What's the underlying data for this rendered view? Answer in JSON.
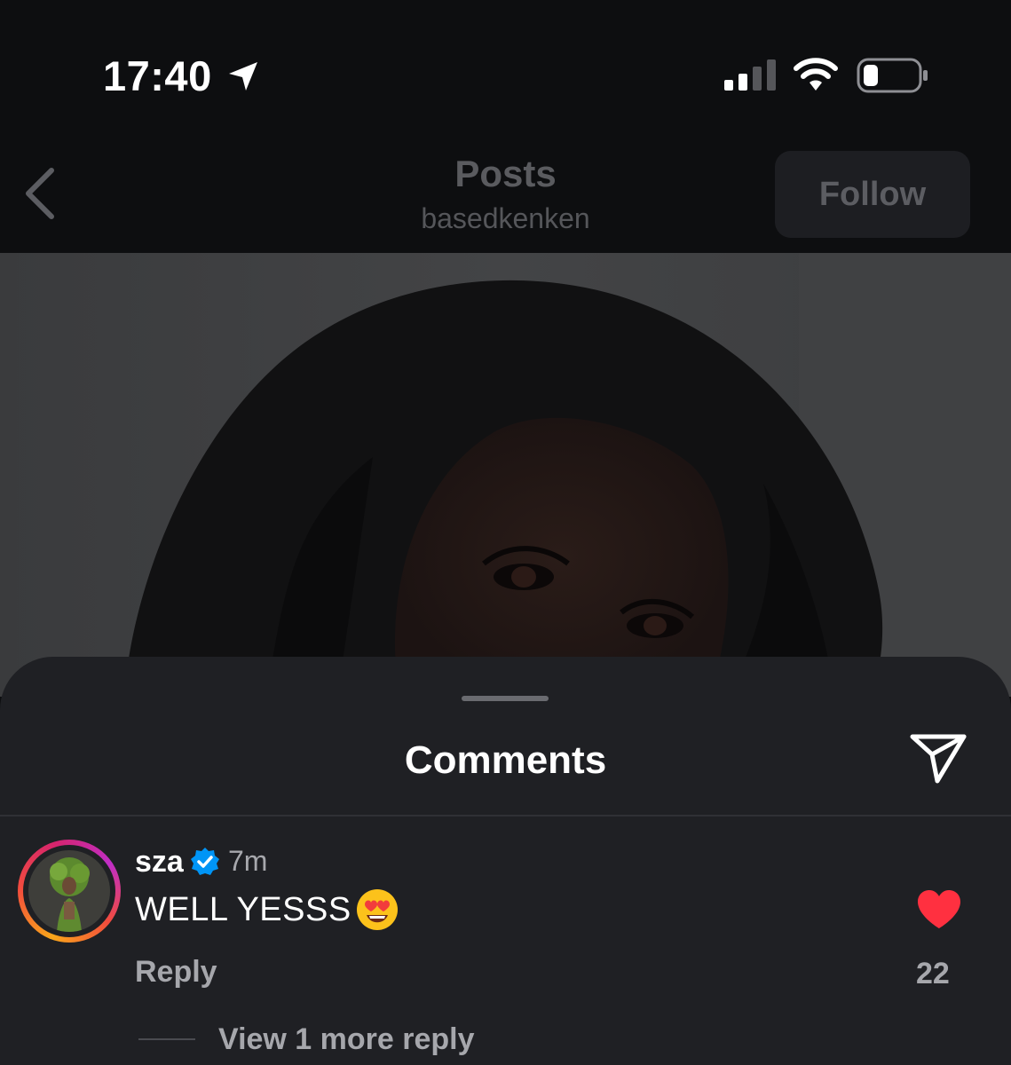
{
  "status_bar": {
    "time": "17:40",
    "icons": [
      "location-arrow-icon",
      "cellular-signal-icon",
      "wifi-icon",
      "battery-icon"
    ]
  },
  "nav": {
    "title": "Posts",
    "subtitle": "basedkenken",
    "follow_label": "Follow",
    "back_icon": "chevron-left-icon"
  },
  "comments_sheet": {
    "title": "Comments",
    "share_icon": "send-icon",
    "comments": [
      {
        "username": "sza",
        "verified": true,
        "time": "7m",
        "text": "WELL YESSS",
        "emoji": "smiling-face-with-heart-eyes",
        "reply_label": "Reply",
        "liked": true,
        "like_count": "22",
        "view_replies_label": "View 1 more reply"
      }
    ]
  },
  "colors": {
    "background": "#0d0e10",
    "sheet": "#1f2024",
    "like": "#ff3040",
    "verified": "#0095f6",
    "muted_text": "#a6a7ac"
  }
}
